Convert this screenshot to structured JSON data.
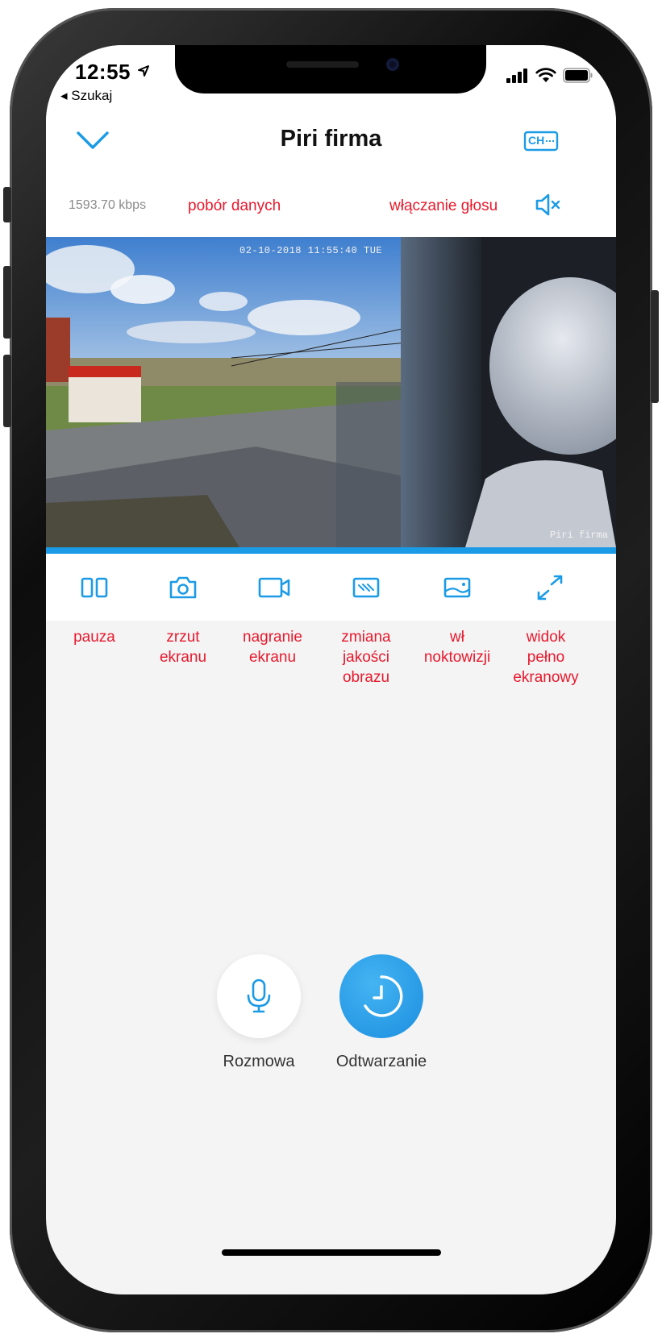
{
  "status_bar": {
    "time": "12:55",
    "back_label": "Szukaj"
  },
  "nav": {
    "title": "Piri firma",
    "channel_button": "CH"
  },
  "stream": {
    "bitrate": "1593.70 kbps"
  },
  "annotations": {
    "data_usage": "pobór danych",
    "sound_toggle": "włączanie głosu",
    "pause": [
      "pauza"
    ],
    "screenshot": [
      "zrzut",
      "ekranu"
    ],
    "record": [
      "nagranie",
      "ekranu"
    ],
    "quality": [
      "zmiana",
      "jakości",
      "obrazu"
    ],
    "night_vision": [
      "wł",
      "noktowizji"
    ],
    "fullscreen": [
      "widok",
      "pełno",
      "ekranowy"
    ]
  },
  "video": {
    "timestamp": "02-10-2018 11:55:40 TUE",
    "camera_label": "Piri firma"
  },
  "actions": {
    "talk_label": "Rozmowa",
    "playback_label": "Odtwarzanie"
  },
  "colors": {
    "accent": "#1b9be6",
    "annotation": "#e8192c",
    "background": "#f4f4f5"
  },
  "toolbar_icons": [
    "pause-icon",
    "camera-icon",
    "video-record-icon",
    "quality-icon",
    "night-vision-icon",
    "fullscreen-icon"
  ]
}
